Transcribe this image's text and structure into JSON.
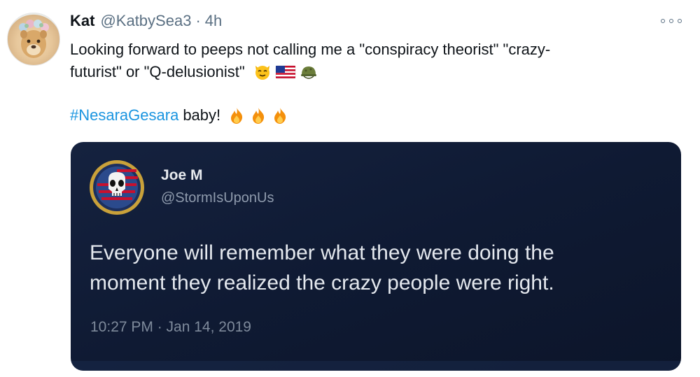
{
  "tweet": {
    "author_name": "Kat",
    "author_handle": "@KatbySea3",
    "separator": "·",
    "time_ago": "4h",
    "text_line1": "Looking forward to peeps not calling me a \"conspiracy theorist\" \"crazy-",
    "text_line2": "futurist\" or \"Q-delusionist\"",
    "hashtag": "#NesaraGesara",
    "text_after_hashtag": "baby!",
    "emojis_line2": [
      "cat-face-emoji",
      "us-flag-emoji",
      "military-helmet-emoji"
    ],
    "emojis_line3": [
      "fire-emoji",
      "fire-emoji",
      "fire-emoji"
    ]
  },
  "quoted_tweet": {
    "author_name": "Joe M",
    "author_handle": "@StormIsUponUs",
    "text_line1": "Everyone will remember what they were doing the",
    "text_line2": "moment they realized the crazy people were right.",
    "timestamp": "10:27 PM · Jan 14, 2019"
  },
  "icons": {
    "more": "more-options-icon"
  },
  "colors": {
    "hashtag": "#1b95e0",
    "muted": "#5b7083",
    "card_background": "#0f1a33"
  }
}
